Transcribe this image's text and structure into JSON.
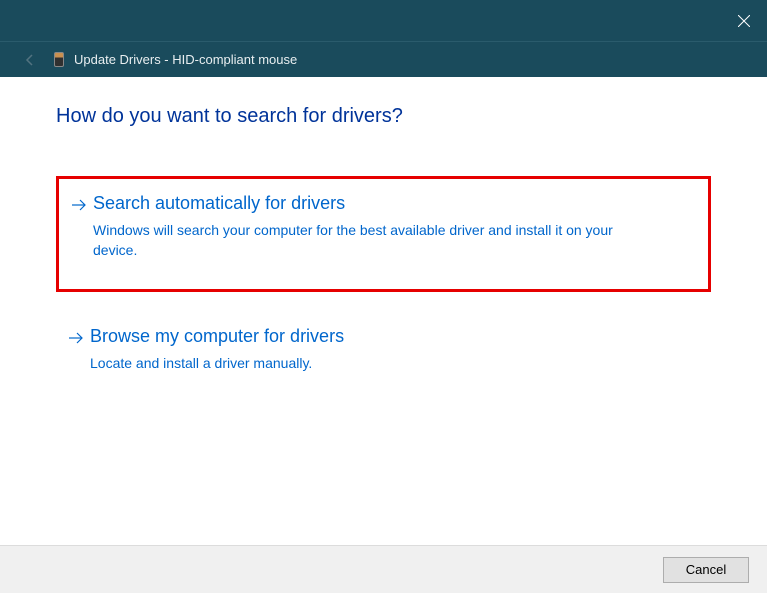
{
  "titlebar": {
    "close_label": "Close"
  },
  "breadcrumb": {
    "text": "Update Drivers - HID-compliant mouse"
  },
  "heading": "How do you want to search for drivers?",
  "options": [
    {
      "title": "Search automatically for drivers",
      "desc": "Windows will search your computer for the best available driver and install it on your device."
    },
    {
      "title": "Browse my computer for drivers",
      "desc": "Locate and install a driver manually."
    }
  ],
  "footer": {
    "cancel_label": "Cancel"
  }
}
